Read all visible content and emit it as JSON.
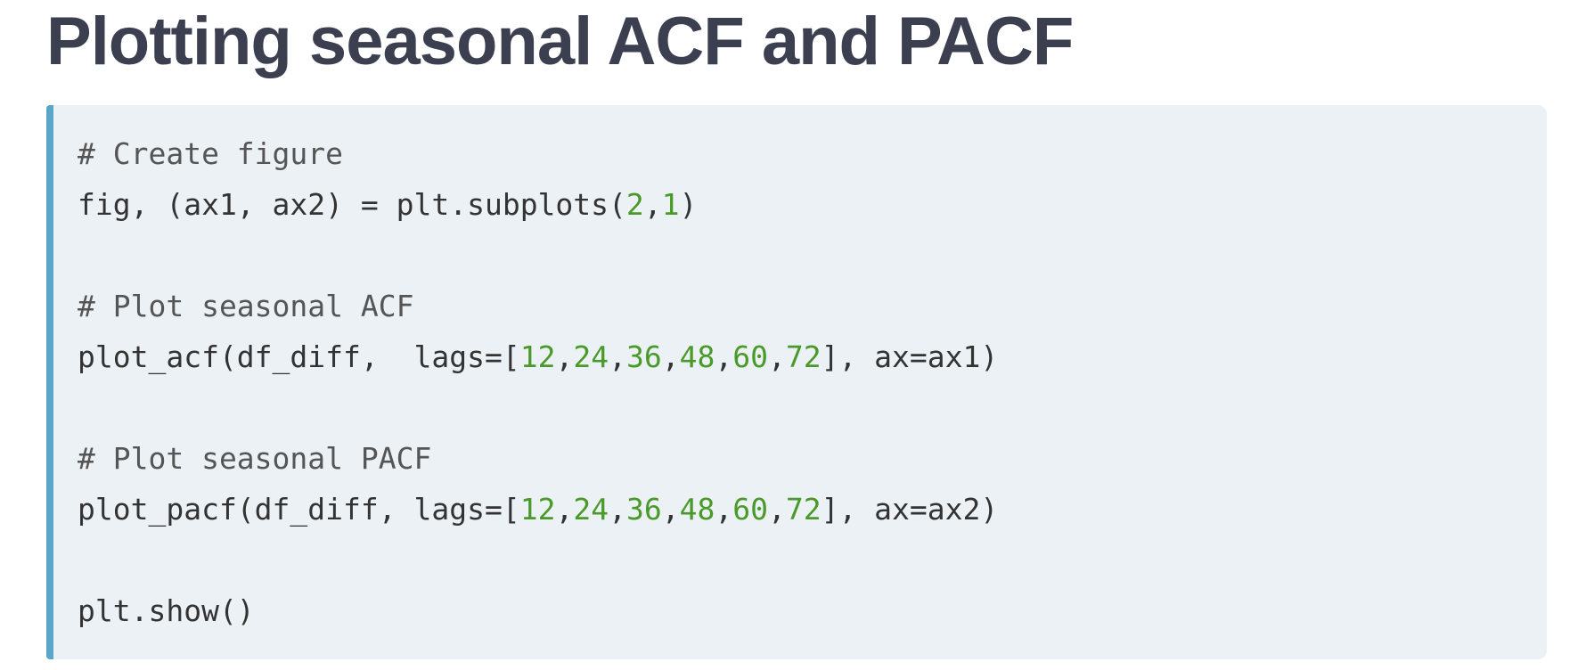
{
  "title": "Plotting seasonal ACF and PACF",
  "colors": {
    "title": "#3b3f4f",
    "code_background": "#ebf1f5",
    "accent_border": "#5aa6c8",
    "number_literal": "#4a9a2a",
    "comment": "#555555",
    "code_text": "#333333"
  },
  "code": {
    "lines": [
      [
        {
          "t": "# Create figure",
          "k": "cm"
        }
      ],
      [
        {
          "t": "fig, (ax1, ax2) = plt.subplots(",
          "k": "tx"
        },
        {
          "t": "2",
          "k": "num"
        },
        {
          "t": ",",
          "k": "tx"
        },
        {
          "t": "1",
          "k": "num"
        },
        {
          "t": ")",
          "k": "tx"
        }
      ],
      [],
      [
        {
          "t": "# Plot seasonal ACF",
          "k": "cm"
        }
      ],
      [
        {
          "t": "plot_acf(df_diff,  lags=[",
          "k": "tx"
        },
        {
          "t": "12",
          "k": "num"
        },
        {
          "t": ",",
          "k": "tx"
        },
        {
          "t": "24",
          "k": "num"
        },
        {
          "t": ",",
          "k": "tx"
        },
        {
          "t": "36",
          "k": "num"
        },
        {
          "t": ",",
          "k": "tx"
        },
        {
          "t": "48",
          "k": "num"
        },
        {
          "t": ",",
          "k": "tx"
        },
        {
          "t": "60",
          "k": "num"
        },
        {
          "t": ",",
          "k": "tx"
        },
        {
          "t": "72",
          "k": "num"
        },
        {
          "t": "], ax=ax1)",
          "k": "tx"
        }
      ],
      [],
      [
        {
          "t": "# Plot seasonal PACF",
          "k": "cm"
        }
      ],
      [
        {
          "t": "plot_pacf(df_diff, lags=[",
          "k": "tx"
        },
        {
          "t": "12",
          "k": "num"
        },
        {
          "t": ",",
          "k": "tx"
        },
        {
          "t": "24",
          "k": "num"
        },
        {
          "t": ",",
          "k": "tx"
        },
        {
          "t": "36",
          "k": "num"
        },
        {
          "t": ",",
          "k": "tx"
        },
        {
          "t": "48",
          "k": "num"
        },
        {
          "t": ",",
          "k": "tx"
        },
        {
          "t": "60",
          "k": "num"
        },
        {
          "t": ",",
          "k": "tx"
        },
        {
          "t": "72",
          "k": "num"
        },
        {
          "t": "], ax=ax2)",
          "k": "tx"
        }
      ],
      [],
      [
        {
          "t": "plt.show()",
          "k": "tx"
        }
      ]
    ]
  }
}
